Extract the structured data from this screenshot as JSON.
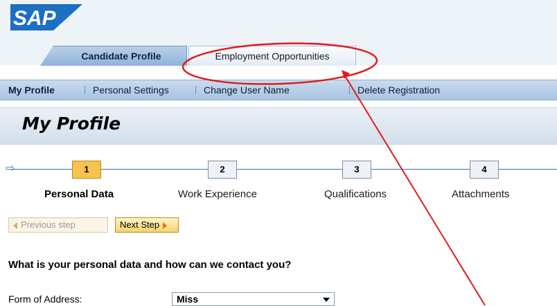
{
  "brand": {
    "logo_text": "SAP",
    "color": "#1c6fc2"
  },
  "tabs": [
    {
      "label": "Candidate Profile",
      "active": true
    },
    {
      "label": "Employment Opportunities",
      "active": false
    }
  ],
  "subnav": [
    {
      "label": "My Profile",
      "active": true
    },
    {
      "label": "Personal Settings"
    },
    {
      "label": "Change User Name"
    },
    {
      "label": "Delete Registration"
    }
  ],
  "page_title": "My Profile",
  "steps": [
    {
      "number": "1",
      "label": "Personal Data",
      "current": true
    },
    {
      "number": "2",
      "label": "Work Experience"
    },
    {
      "number": "3",
      "label": "Qualifications"
    },
    {
      "number": "4",
      "label": "Attachments"
    }
  ],
  "buttons": {
    "previous": "Previous step",
    "next": "Next Step"
  },
  "question": "What is your personal data and how can we contact you?",
  "form": {
    "form_of_address_label": "Form of Address:",
    "form_of_address_value": "Miss"
  },
  "colors": {
    "annotation": "#e31b1b",
    "step_current": "#f7c24d",
    "nav_bg": "#a9c4e1"
  }
}
